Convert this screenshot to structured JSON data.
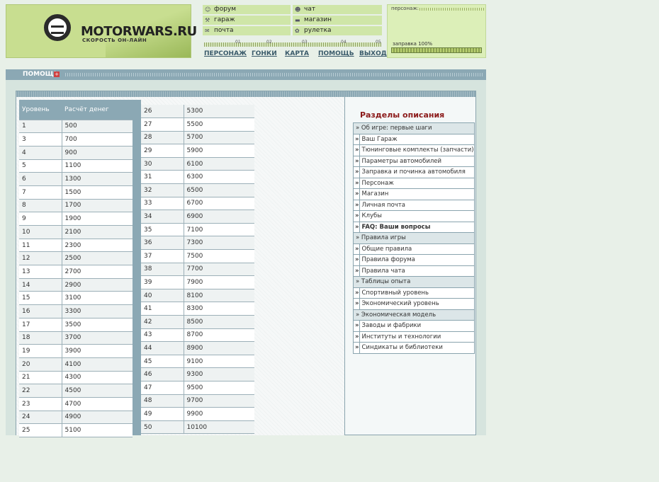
{
  "brand": {
    "logo_text": "MOTORWARS.RU",
    "logo_sub": "СКОРОСТЬ ОН-ЛАЙН"
  },
  "top_menu": [
    {
      "label": "форум",
      "icon": "chat-bubbles-icon"
    },
    {
      "label": "чат",
      "icon": "smiley-icon"
    },
    {
      "label": "гараж",
      "icon": "wrench-icon"
    },
    {
      "label": "магазин",
      "icon": "car-icon"
    },
    {
      "label": "почта",
      "icon": "envelope-icon"
    },
    {
      "label": "рулетка",
      "icon": "roulette-icon"
    }
  ],
  "progress_ticks": [
    "01",
    "02",
    "03",
    "04",
    "05"
  ],
  "nav": [
    "ПЕРСОНАЖ",
    "ГОНКИ",
    "КАРТА",
    "ПОМОЩЬ",
    "ВЫХОД"
  ],
  "character": {
    "title": "персонаж:",
    "fuel_label": "заправка 100%",
    "fuel_percent": 100
  },
  "help_section": {
    "title": "ПОМОЩЬ",
    "plus": "+"
  },
  "xp_table": {
    "headers": [
      "Уровень",
      "Расчёт денег"
    ],
    "left": [
      [
        "1",
        "500"
      ],
      [
        "3",
        "700"
      ],
      [
        "4",
        "900"
      ],
      [
        "5",
        "1100"
      ],
      [
        "6",
        "1300"
      ],
      [
        "7",
        "1500"
      ],
      [
        "8",
        "1700"
      ],
      [
        "9",
        "1900"
      ],
      [
        "10",
        "2100"
      ],
      [
        "11",
        "2300"
      ],
      [
        "12",
        "2500"
      ],
      [
        "13",
        "2700"
      ],
      [
        "14",
        "2900"
      ],
      [
        "15",
        "3100"
      ],
      [
        "16",
        "3300"
      ],
      [
        "17",
        "3500"
      ],
      [
        "18",
        "3700"
      ],
      [
        "19",
        "3900"
      ],
      [
        "20",
        "4100"
      ],
      [
        "21",
        "4300"
      ],
      [
        "22",
        "4500"
      ],
      [
        "23",
        "4700"
      ],
      [
        "24",
        "4900"
      ],
      [
        "25",
        "5100"
      ]
    ],
    "right": [
      [
        "26",
        "5300"
      ],
      [
        "27",
        "5500"
      ],
      [
        "28",
        "5700"
      ],
      [
        "29",
        "5900"
      ],
      [
        "30",
        "6100"
      ],
      [
        "31",
        "6300"
      ],
      [
        "32",
        "6500"
      ],
      [
        "33",
        "6700"
      ],
      [
        "34",
        "6900"
      ],
      [
        "35",
        "7100"
      ],
      [
        "36",
        "7300"
      ],
      [
        "37",
        "7500"
      ],
      [
        "38",
        "7700"
      ],
      [
        "39",
        "7900"
      ],
      [
        "40",
        "8100"
      ],
      [
        "41",
        "8300"
      ],
      [
        "42",
        "8500"
      ],
      [
        "43",
        "8700"
      ],
      [
        "44",
        "8900"
      ],
      [
        "45",
        "9100"
      ],
      [
        "46",
        "9300"
      ],
      [
        "47",
        "9500"
      ],
      [
        "48",
        "9700"
      ],
      [
        "49",
        "9900"
      ],
      [
        "50",
        "10100"
      ]
    ]
  },
  "sections": {
    "title": "Разделы описания",
    "items": [
      {
        "type": "header",
        "label": "» Об игре: первые шаги"
      },
      {
        "type": "item",
        "label": "Ваш Гараж"
      },
      {
        "type": "item",
        "label": "Тюнинговые комплекты (запчасти)"
      },
      {
        "type": "item",
        "label": "Параметры автомобилей"
      },
      {
        "type": "item",
        "label": "Заправка и починка автомобиля"
      },
      {
        "type": "item",
        "label": "Персонаж"
      },
      {
        "type": "item",
        "label": "Магазин"
      },
      {
        "type": "item",
        "label": "Личная почта"
      },
      {
        "type": "item",
        "label": "Клубы"
      },
      {
        "type": "item",
        "label": "FAQ: Ваши вопросы",
        "bold": true
      },
      {
        "type": "header",
        "label": "» Правила игры"
      },
      {
        "type": "item",
        "label": "Общие правила"
      },
      {
        "type": "item",
        "label": "Правила форума"
      },
      {
        "type": "item",
        "label": "Правила чата"
      },
      {
        "type": "header",
        "label": "» Таблицы опыта"
      },
      {
        "type": "item",
        "label": "Спортивный уровень"
      },
      {
        "type": "item",
        "label": "Экономический уровень"
      },
      {
        "type": "header",
        "label": "» Экономическая модель"
      },
      {
        "type": "item",
        "label": "Заводы и фабрики"
      },
      {
        "type": "item",
        "label": "Институты и технологии"
      },
      {
        "type": "item",
        "label": "Синдикаты и библиотеки"
      }
    ],
    "marker": "»"
  }
}
